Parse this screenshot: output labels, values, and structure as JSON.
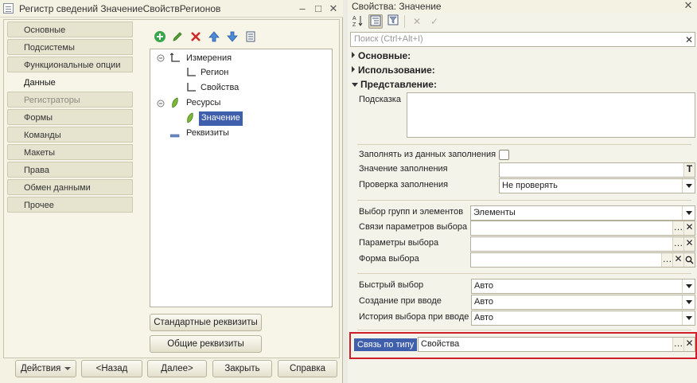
{
  "left_window": {
    "title": "Регистр сведений ЗначениеСвойствРегионов",
    "nav_items": [
      {
        "label": "Основные"
      },
      {
        "label": "Подсистемы"
      },
      {
        "label": "Функциональные опции"
      },
      {
        "label": "Данные"
      },
      {
        "label": "Регистраторы"
      },
      {
        "label": "Формы"
      },
      {
        "label": "Команды"
      },
      {
        "label": "Макеты"
      },
      {
        "label": "Права"
      },
      {
        "label": "Обмен данными"
      },
      {
        "label": "Прочее"
      }
    ],
    "active_nav": "Данные",
    "tree": {
      "dimensions": "Измерения",
      "dim_region": "Регион",
      "dim_props": "Свойства",
      "resources": "Ресурсы",
      "res_value": "Значение",
      "attributes": "Реквизиты"
    },
    "btn_standard": "Стандартные реквизиты",
    "btn_common": "Общие реквизиты",
    "footer": {
      "actions": "Действия",
      "back": "<Назад",
      "next": "Далее>",
      "close": "Закрыть",
      "help": "Справка"
    }
  },
  "right_panel": {
    "title": "Свойства: Значение",
    "search_placeholder": "Поиск (Ctrl+Alt+I)",
    "sections": {
      "basic": "Основные:",
      "usage": "Использование:",
      "view": "Представление:"
    },
    "hint_label": "Подсказка",
    "fill_from_data_label": "Заполнять из данных заполнения",
    "fill_value_label": "Значение заполнения",
    "fill_check_label": "Проверка заполнения",
    "fill_check_value": "Не проверять",
    "group_select_label": "Выбор групп и элементов",
    "group_select_value": "Элементы",
    "choice_links_label": "Связи параметров выбора",
    "choice_params_label": "Параметры выбора",
    "choice_form_label": "Форма выбора",
    "quick_choice_label": "Быстрый выбор",
    "quick_choice_value": "Авто",
    "create_on_input_label": "Создание при вводе",
    "create_on_input_value": "Авто",
    "history_label": "История выбора при вводе",
    "history_value": "Авто",
    "link_by_type_label": "Связь по типу",
    "link_by_type_value": "Свойства"
  },
  "colors": {
    "selection": "#3f5eab",
    "highlight_border": "#d01f2a"
  }
}
